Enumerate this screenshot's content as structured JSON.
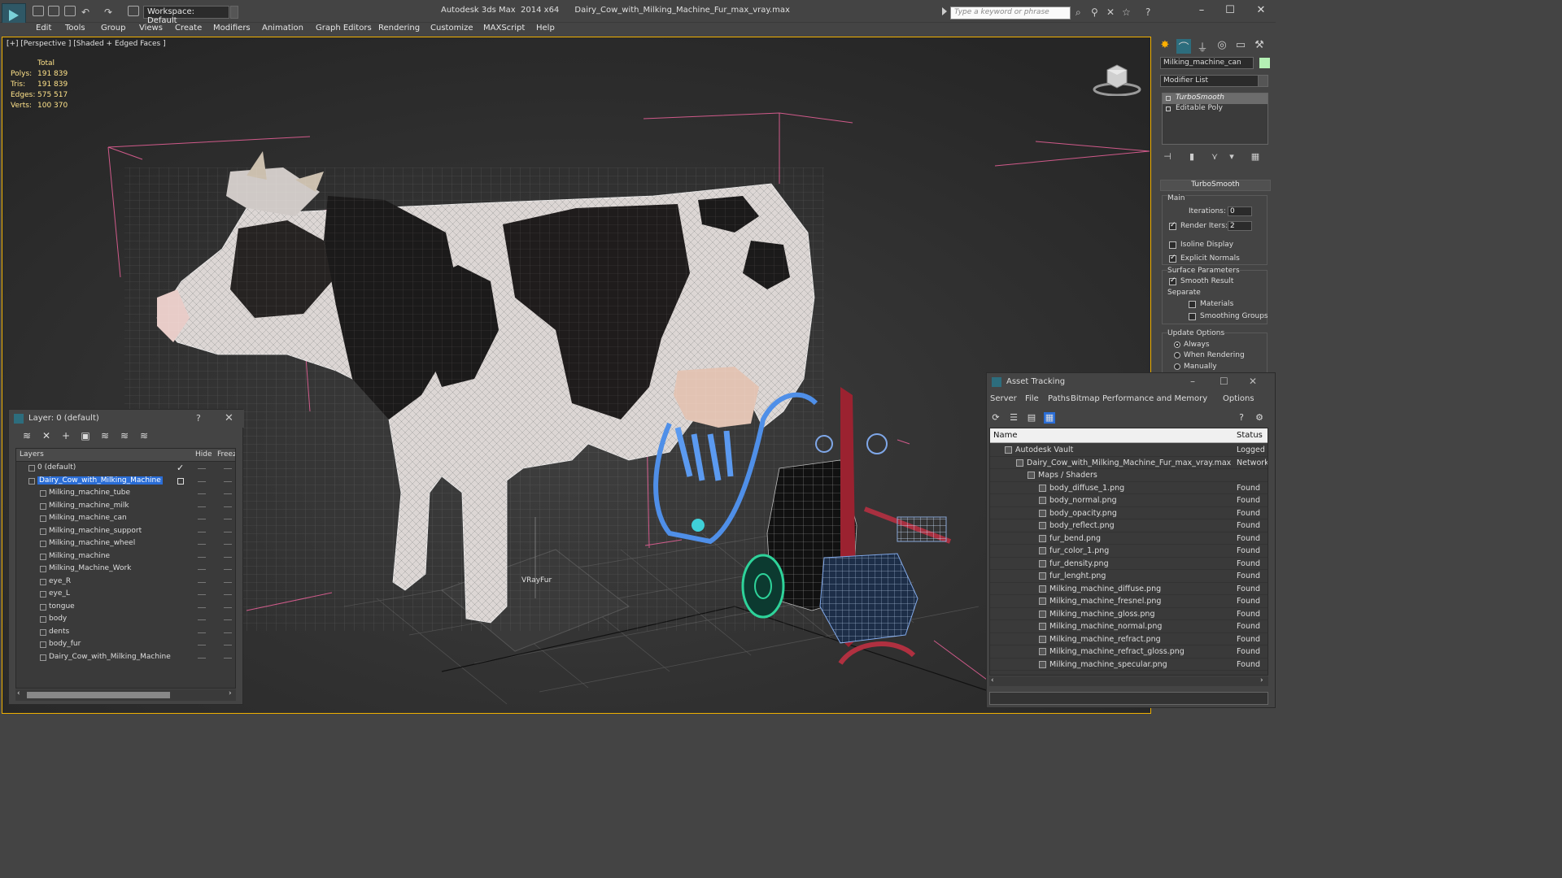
{
  "app": {
    "title": "Autodesk 3ds Max  2014 x64",
    "file": "Dairy_Cow_with_Milking_Machine_Fur_max_vray.max",
    "workspace": "Workspace: Default",
    "search_placeholder": "Type a keyword or phrase"
  },
  "menus": [
    "Edit",
    "Tools",
    "Group",
    "Views",
    "Create",
    "Modifiers",
    "Animation",
    "Graph Editors",
    "Rendering",
    "Customize",
    "MAXScript",
    "Help"
  ],
  "viewport": {
    "label": "[+] [Perspective ] [Shaded + Edged Faces ]",
    "stats": {
      "header": "Total",
      "rows": [
        {
          "k": "Polys:",
          "v": "191 839"
        },
        {
          "k": "Tris:",
          "v": "191 839"
        },
        {
          "k": "Edges:",
          "v": "575 517"
        },
        {
          "k": "Verts:",
          "v": "100 370"
        }
      ]
    },
    "fur_label": "VRayFur"
  },
  "command_panel": {
    "object_name": "Milking_machine_can",
    "object_color": "#b4f0b4",
    "modifier_list": "Modifier List",
    "stack": [
      "TurboSmooth",
      "Editable Poly"
    ],
    "rollout_title": "TurboSmooth",
    "main_label": "Main",
    "iterations_label": "Iterations:",
    "iterations_value": "0",
    "render_iters_label": "Render Iters:",
    "render_iters_value": "2",
    "isoline": "Isoline Display",
    "explicit_normals": "Explicit Normals",
    "surface_params": "Surface Parameters",
    "smooth_result": "Smooth Result",
    "separate": "Separate",
    "materials": "Materials",
    "smoothing_groups": "Smoothing Groups",
    "update_options": "Update Options",
    "always": "Always",
    "when_rendering": "When Rendering",
    "manually": "Manually"
  },
  "layers": {
    "title": "Layer: 0 (default)",
    "help": "?",
    "col_layers": "Layers",
    "col_hide": "Hide",
    "col_freeze": "Freez",
    "rows": [
      {
        "name": "0 (default)",
        "level": 0
      },
      {
        "name": "Dairy_Cow_with_Milking_Machine",
        "level": 0
      },
      {
        "name": "Milking_machine_tube",
        "level": 1
      },
      {
        "name": "Milking_machine_milk",
        "level": 1
      },
      {
        "name": "Milking_machine_can",
        "level": 1
      },
      {
        "name": "Milking_machine_support",
        "level": 1
      },
      {
        "name": "Milking_machine_wheel",
        "level": 1
      },
      {
        "name": "Milking_machine",
        "level": 1
      },
      {
        "name": "Milking_Machine_Work",
        "level": 1
      },
      {
        "name": "eye_R",
        "level": 1
      },
      {
        "name": "eye_L",
        "level": 1
      },
      {
        "name": "tongue",
        "level": 1
      },
      {
        "name": "body",
        "level": 1
      },
      {
        "name": "dents",
        "level": 1
      },
      {
        "name": "body_fur",
        "level": 1
      },
      {
        "name": "Dairy_Cow_with_Milking_Machine",
        "level": 1
      }
    ]
  },
  "asset_tracking": {
    "title": "Asset Tracking",
    "menu": [
      "Server",
      "File",
      "Paths",
      "Bitmap Performance and Memory",
      "Options"
    ],
    "col_name": "Name",
    "col_status": "Status",
    "rows": [
      {
        "name": "Autodesk Vault",
        "status": "Logged O",
        "indent": 18
      },
      {
        "name": "Dairy_Cow_with_Milking_Machine_Fur_max_vray.max",
        "status": "Network",
        "indent": 32
      },
      {
        "name": "Maps / Shaders",
        "status": "",
        "indent": 46
      },
      {
        "name": "body_diffuse_1.png",
        "status": "Found",
        "indent": 60
      },
      {
        "name": "body_normal.png",
        "status": "Found",
        "indent": 60
      },
      {
        "name": "body_opacity.png",
        "status": "Found",
        "indent": 60
      },
      {
        "name": "body_reflect.png",
        "status": "Found",
        "indent": 60
      },
      {
        "name": "fur_bend.png",
        "status": "Found",
        "indent": 60
      },
      {
        "name": "fur_color_1.png",
        "status": "Found",
        "indent": 60
      },
      {
        "name": "fur_density.png",
        "status": "Found",
        "indent": 60
      },
      {
        "name": "fur_lenght.png",
        "status": "Found",
        "indent": 60
      },
      {
        "name": "Milking_machine_diffuse.png",
        "status": "Found",
        "indent": 60
      },
      {
        "name": "Milking_machine_fresnel.png",
        "status": "Found",
        "indent": 60
      },
      {
        "name": "Milking_machine_gloss.png",
        "status": "Found",
        "indent": 60
      },
      {
        "name": "Milking_machine_normal.png",
        "status": "Found",
        "indent": 60
      },
      {
        "name": "Milking_machine_refract.png",
        "status": "Found",
        "indent": 60
      },
      {
        "name": "Milking_machine_refract_gloss.png",
        "status": "Found",
        "indent": 60
      },
      {
        "name": "Milking_machine_specular.png",
        "status": "Found",
        "indent": 60
      }
    ]
  }
}
